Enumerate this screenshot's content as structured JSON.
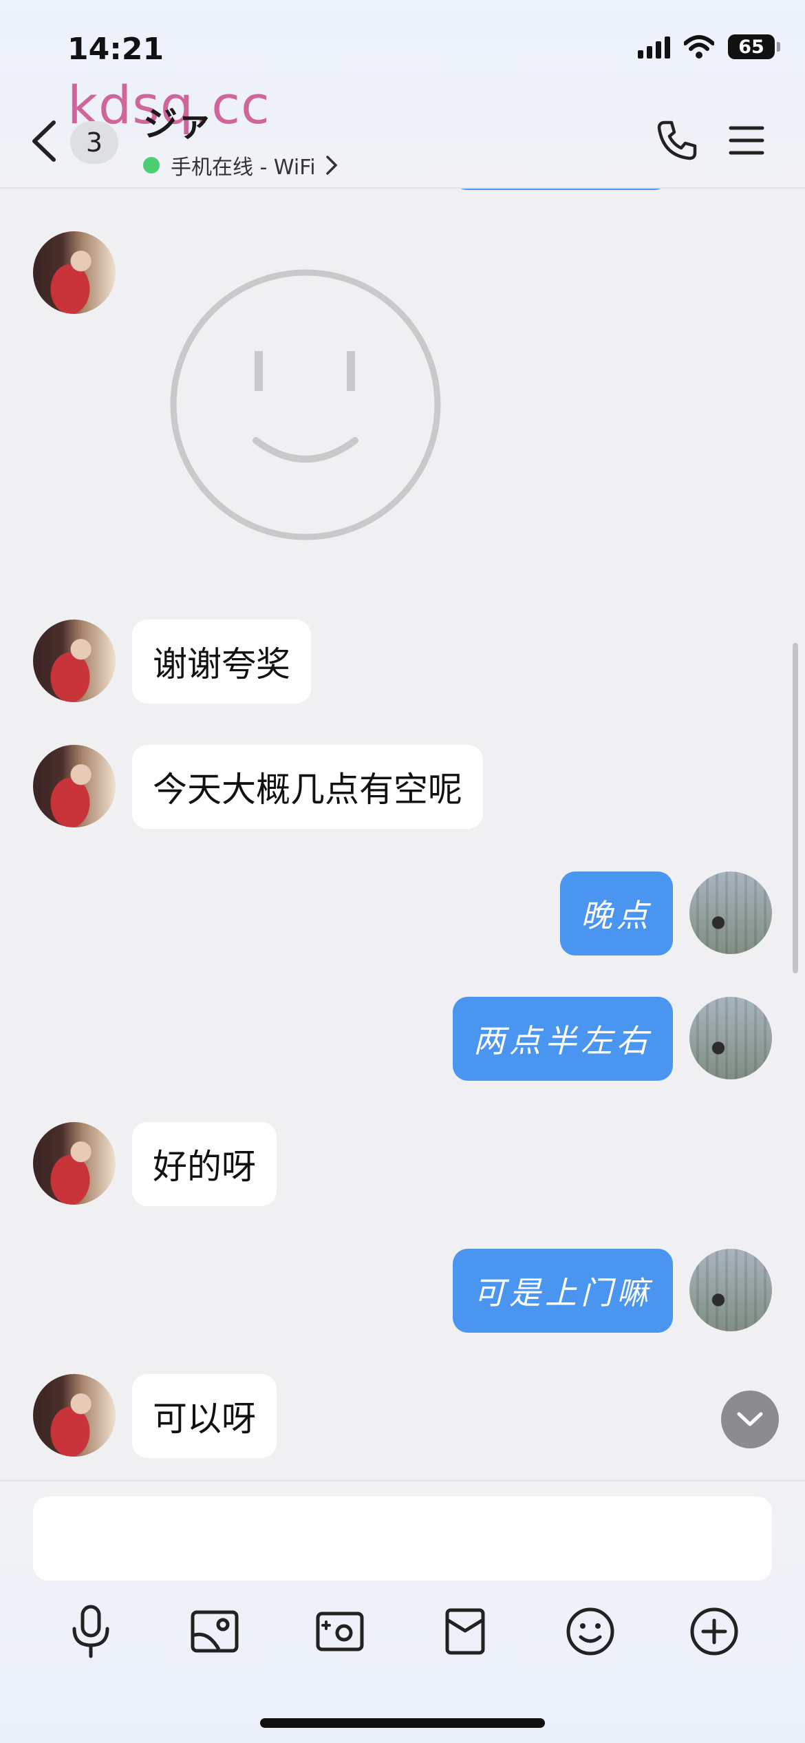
{
  "status_bar": {
    "time": "14:21",
    "battery": "65"
  },
  "watermark": "kdsq.cc",
  "header": {
    "unread_count": "3",
    "contact_name": "ジァ",
    "online_status": "手机在线 - WiFi"
  },
  "messages": [
    {
      "from": "them",
      "type": "sticker",
      "sticker": "smiley-face"
    },
    {
      "from": "them",
      "text": "谢谢夸奖"
    },
    {
      "from": "them",
      "text": "今天大概几点有空呢"
    },
    {
      "from": "me",
      "text": "晚点"
    },
    {
      "from": "me",
      "text": "两点半左右"
    },
    {
      "from": "them",
      "text": "好的呀"
    },
    {
      "from": "me",
      "text": "可是上门嘛"
    },
    {
      "from": "them",
      "text": "可以呀"
    }
  ],
  "input": {
    "placeholder": ""
  },
  "toolbar_icons": [
    "microphone-icon",
    "image-icon",
    "camera-icon",
    "red-packet-icon",
    "emoji-icon",
    "plus-icon"
  ],
  "colors": {
    "accent": "#4a95f0",
    "online": "#4ccf73",
    "watermark": "#d0659a"
  }
}
